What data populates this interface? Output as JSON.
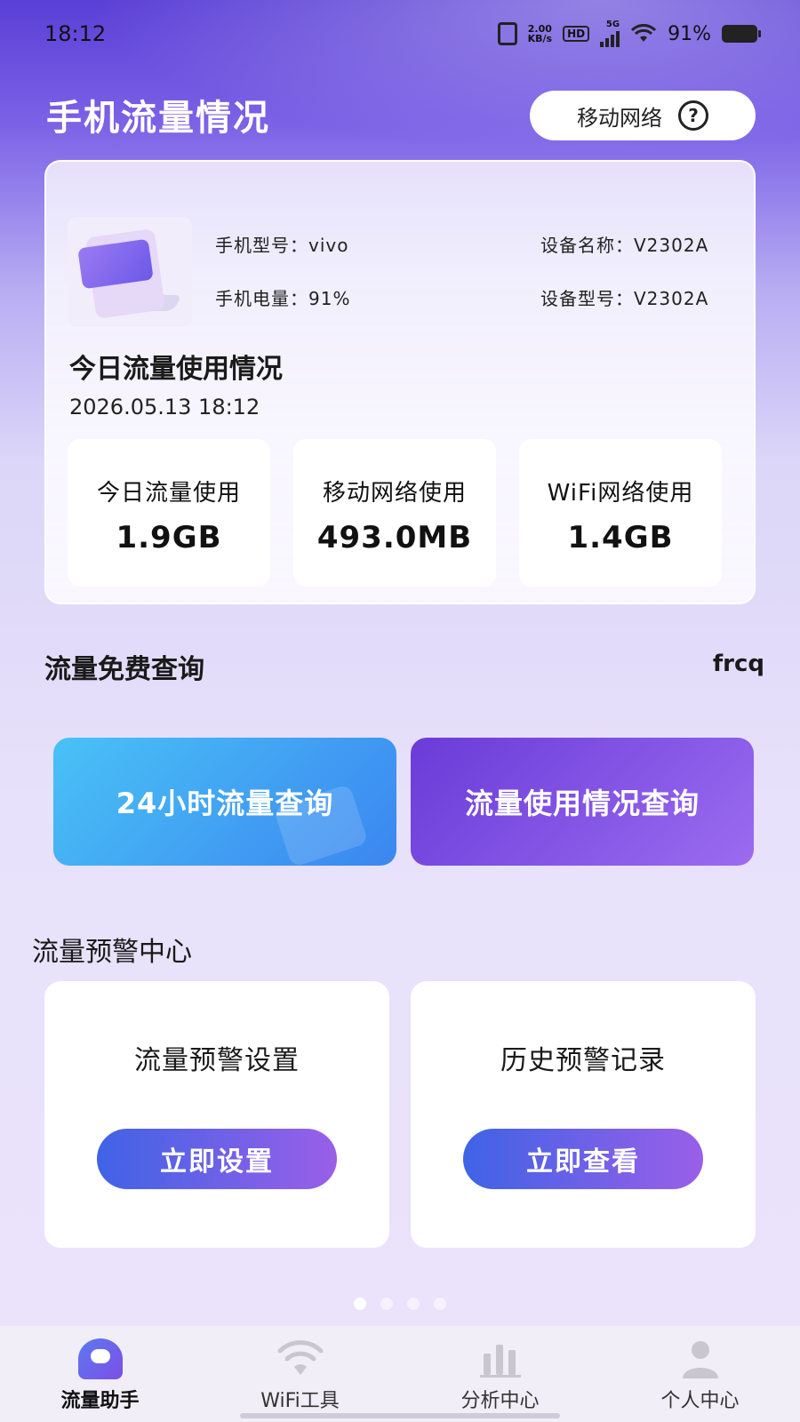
{
  "status_bar": {
    "time": "18:12",
    "speed": "2.00\nKB/s",
    "hd": "HD",
    "network_type": "5G",
    "battery": "91%"
  },
  "header": {
    "title": "手机流量情况",
    "network_label": "移动网络",
    "help_icon": "?"
  },
  "device": {
    "model_label": "手机型号：vivo",
    "battery_label": "手机电量：91%",
    "name_label": "设备名称：V2302A",
    "type_label": "设备型号：V2302A"
  },
  "today": {
    "title": "今日流量使用情况",
    "datetime": "2026.05.13 18:12",
    "stats": [
      {
        "label": "今日流量使用",
        "value": "1.9GB"
      },
      {
        "label": "移动网络使用",
        "value": "493.0MB"
      },
      {
        "label": "WiFi网络使用",
        "value": "1.4GB"
      }
    ]
  },
  "free_query": {
    "title": "流量免费查询",
    "code": "frcq",
    "buttons": [
      "24小时流量查询",
      "流量使用情况查询"
    ]
  },
  "warning": {
    "title": "流量预警中心",
    "cards": [
      {
        "title": "流量预警设置",
        "button": "立即设置"
      },
      {
        "title": "历史预警记录",
        "button": "立即查看"
      }
    ]
  },
  "pager": {
    "count": 4,
    "active_index": 0
  },
  "bottom_nav": {
    "items": [
      {
        "label": "流量助手",
        "icon": "assistant-icon"
      },
      {
        "label": "WiFi工具",
        "icon": "wifi-icon"
      },
      {
        "label": "分析中心",
        "icon": "chart-icon"
      },
      {
        "label": "个人中心",
        "icon": "person-icon"
      }
    ],
    "active_index": 0
  },
  "colors": {
    "accent_purple": "#6a3bd8",
    "accent_blue": "#3b86f0",
    "header_top": "#5a3fd6"
  }
}
